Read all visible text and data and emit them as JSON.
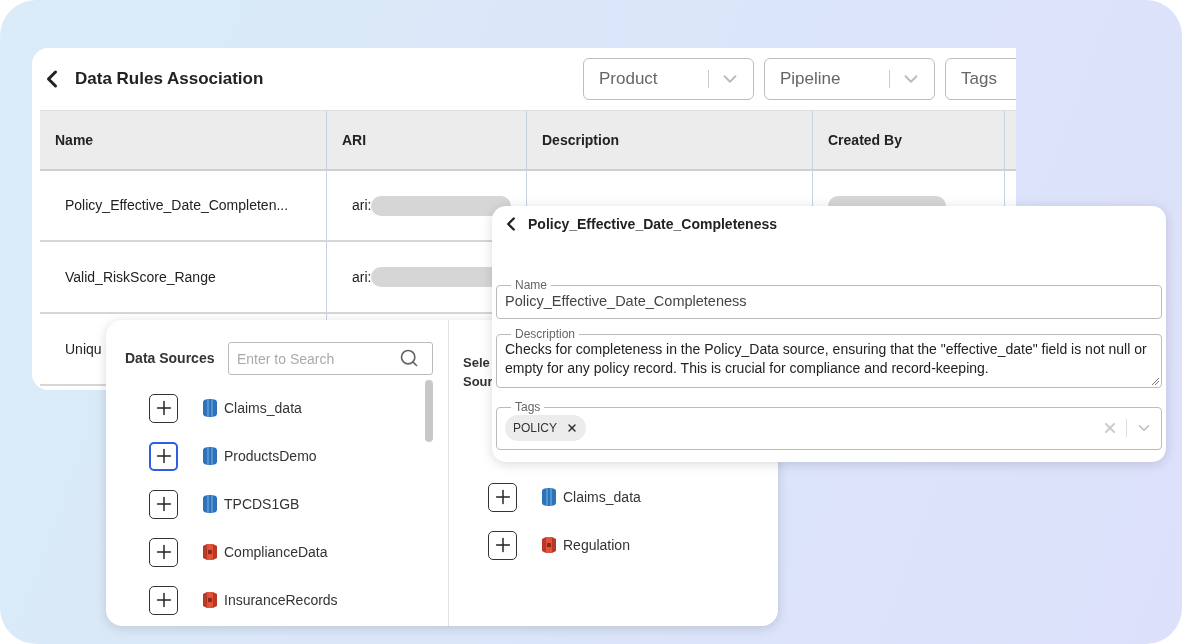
{
  "header": {
    "title": "Data Rules Association",
    "filters": [
      {
        "label": "Product",
        "kind": "dropdown"
      },
      {
        "label": "Pipeline",
        "kind": "dropdown"
      },
      {
        "label": "Tags",
        "kind": "plain"
      }
    ]
  },
  "table": {
    "columns": [
      "Name",
      "ARI",
      "Description",
      "Created By"
    ],
    "rows": [
      {
        "name": "Policy_Effective_Date_Completen...",
        "ari": "ari:",
        "created_by_redacted": true
      },
      {
        "name": "Valid_RiskScore_Range",
        "ari": "ari:"
      },
      {
        "name": "Uniqu"
      }
    ]
  },
  "sources_dialog": {
    "title": "Data Sources",
    "search": {
      "placeholder": "Enter to Search"
    },
    "sources": [
      {
        "label": "Claims_data",
        "kind": "database",
        "focused": false
      },
      {
        "label": "ProductsDemo",
        "kind": "database",
        "focused": true
      },
      {
        "label": "TPCDS1GB",
        "kind": "database",
        "focused": false
      },
      {
        "label": "ComplianceData",
        "kind": "bucket",
        "focused": false
      },
      {
        "label": "InsuranceRecords",
        "kind": "bucket",
        "focused": false
      }
    ],
    "selected_heading": [
      "Sele",
      "Sour"
    ],
    "selected_sources": [
      {
        "label": "Claims_data",
        "kind": "database",
        "focused": false
      },
      {
        "label": "Regulation",
        "kind": "bucket",
        "focused": false
      }
    ]
  },
  "detail": {
    "title": "Policy_Effective_Date_Completeness",
    "name": {
      "label": "Name",
      "value": "Policy_Effective_Date_Completeness"
    },
    "description": {
      "label": "Description",
      "value": "Checks for completeness in the Policy_Data source, ensuring that the \"effective_date\" field is not null or empty for any policy record. This is crucial for compliance and record-keeping."
    },
    "tags": {
      "label": "Tags",
      "chips": [
        "POLICY"
      ]
    }
  }
}
